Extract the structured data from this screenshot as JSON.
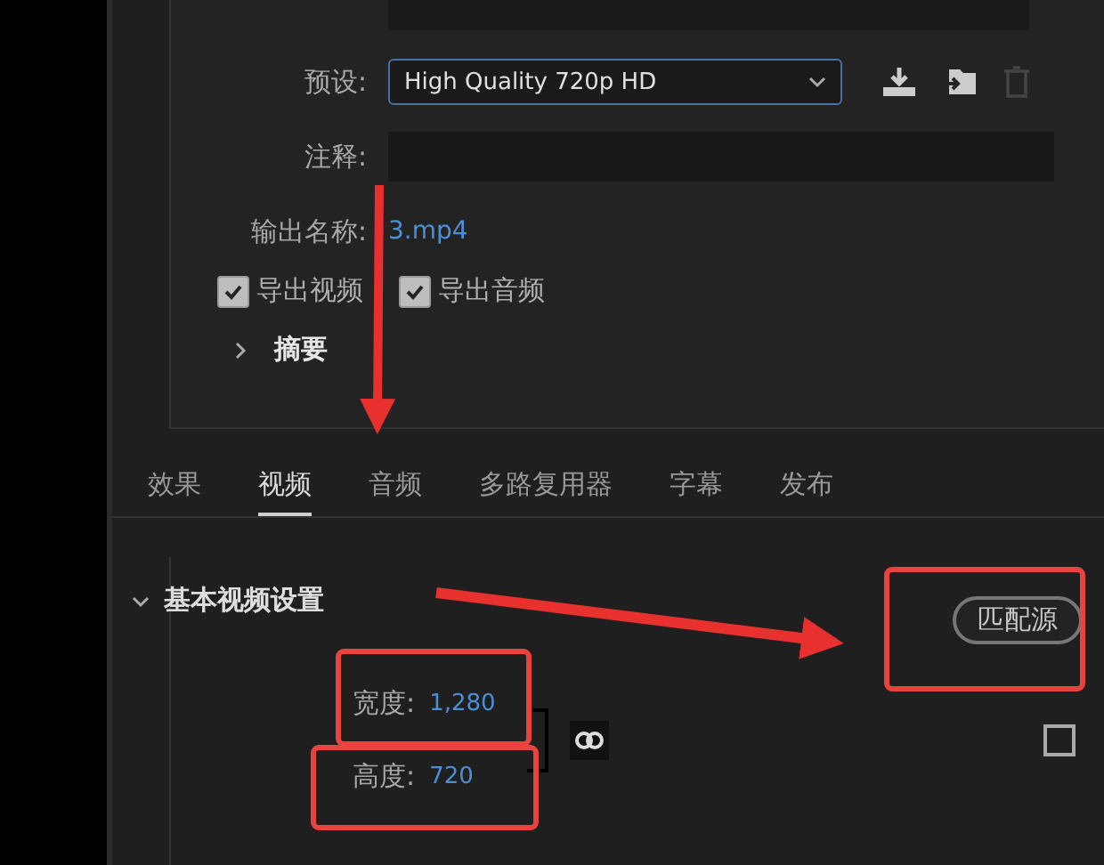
{
  "export_panel": {
    "fields": [
      {
        "kind": "text"
      },
      {
        "kind": "dropdown",
        "label": "预设:",
        "value": "High Quality 720p HD"
      },
      {
        "kind": "input",
        "label": "注释:"
      },
      {
        "kind": "link",
        "label": "输出名称:",
        "value": "3.mp4"
      }
    ],
    "checkboxes": [
      {
        "label": "导出视频",
        "checked": true
      },
      {
        "label": "导出音频",
        "checked": true
      }
    ],
    "summary": {
      "label": "摘要",
      "expanded": false
    }
  },
  "tabs": [
    {
      "label": "效果",
      "selected": false
    },
    {
      "label": "视频",
      "selected": true
    },
    {
      "label": "音频",
      "selected": false
    },
    {
      "label": "多路复用器",
      "selected": false
    },
    {
      "label": "字幕",
      "selected": false
    },
    {
      "label": "发布",
      "selected": false
    }
  ],
  "video_section": {
    "title": "基本视频设置",
    "expanded": true,
    "match_button": "匹配源",
    "width": {
      "label": "宽度:",
      "value": "1,280"
    },
    "height": {
      "label": "高度:",
      "value": "720"
    },
    "linked": true,
    "custom_checked": false
  }
}
